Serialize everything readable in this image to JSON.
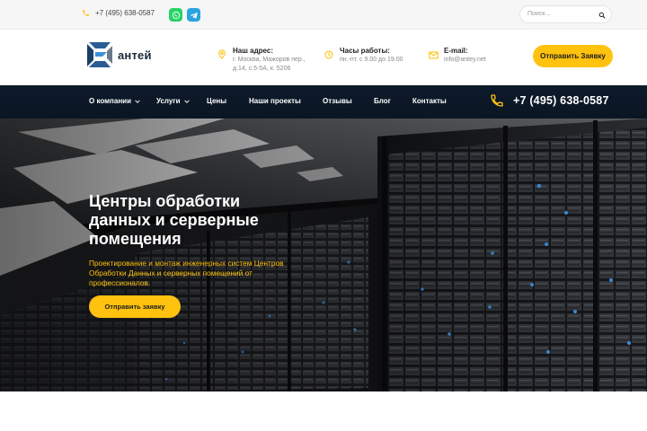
{
  "topbar": {
    "phone": "+7 (495) 638-0587",
    "messengers": [
      "whatsapp-icon",
      "telegram-icon"
    ],
    "search": {
      "placeholder": "Поиск...",
      "value": ""
    }
  },
  "header": {
    "logo_text": "антей",
    "address": {
      "title": "Наш адрес:",
      "lines": [
        "г. Москва, Мажоров пер.,",
        "д.14, с.5-5А, к. 5206"
      ]
    },
    "hours": {
      "title": "Часы работы:",
      "text": "пн.-пт. с 9.00 до 19.00"
    },
    "email": {
      "title": "E-mail:",
      "text": "info@antey.net"
    },
    "cta_label": "Отправить Заявку"
  },
  "nav": {
    "items": [
      {
        "label": "О компании",
        "has_dropdown": true
      },
      {
        "label": "Услуги",
        "has_dropdown": true
      },
      {
        "label": "Цены",
        "has_dropdown": false
      },
      {
        "label": "Наши проекты",
        "has_dropdown": false
      },
      {
        "label": "Отзывы",
        "has_dropdown": false
      },
      {
        "label": "Блог",
        "has_dropdown": false
      },
      {
        "label": "Контакты",
        "has_dropdown": false
      }
    ],
    "phone": "+7 (495) 638-0587"
  },
  "hero": {
    "title": "Центры обработки данных и серверные помещения",
    "subtitle": "Проектирование и монтаж инженерных систем Центров Обработки Данных и серверных помещений от профессионалов.",
    "cta_label": "Отправить заявку"
  },
  "colors": {
    "accent": "#ffc20e",
    "nav_bg": "#0d1a2a",
    "whatsapp": "#25d366",
    "telegram": "#2aa3de",
    "logo_blue": "#2b5d93"
  }
}
